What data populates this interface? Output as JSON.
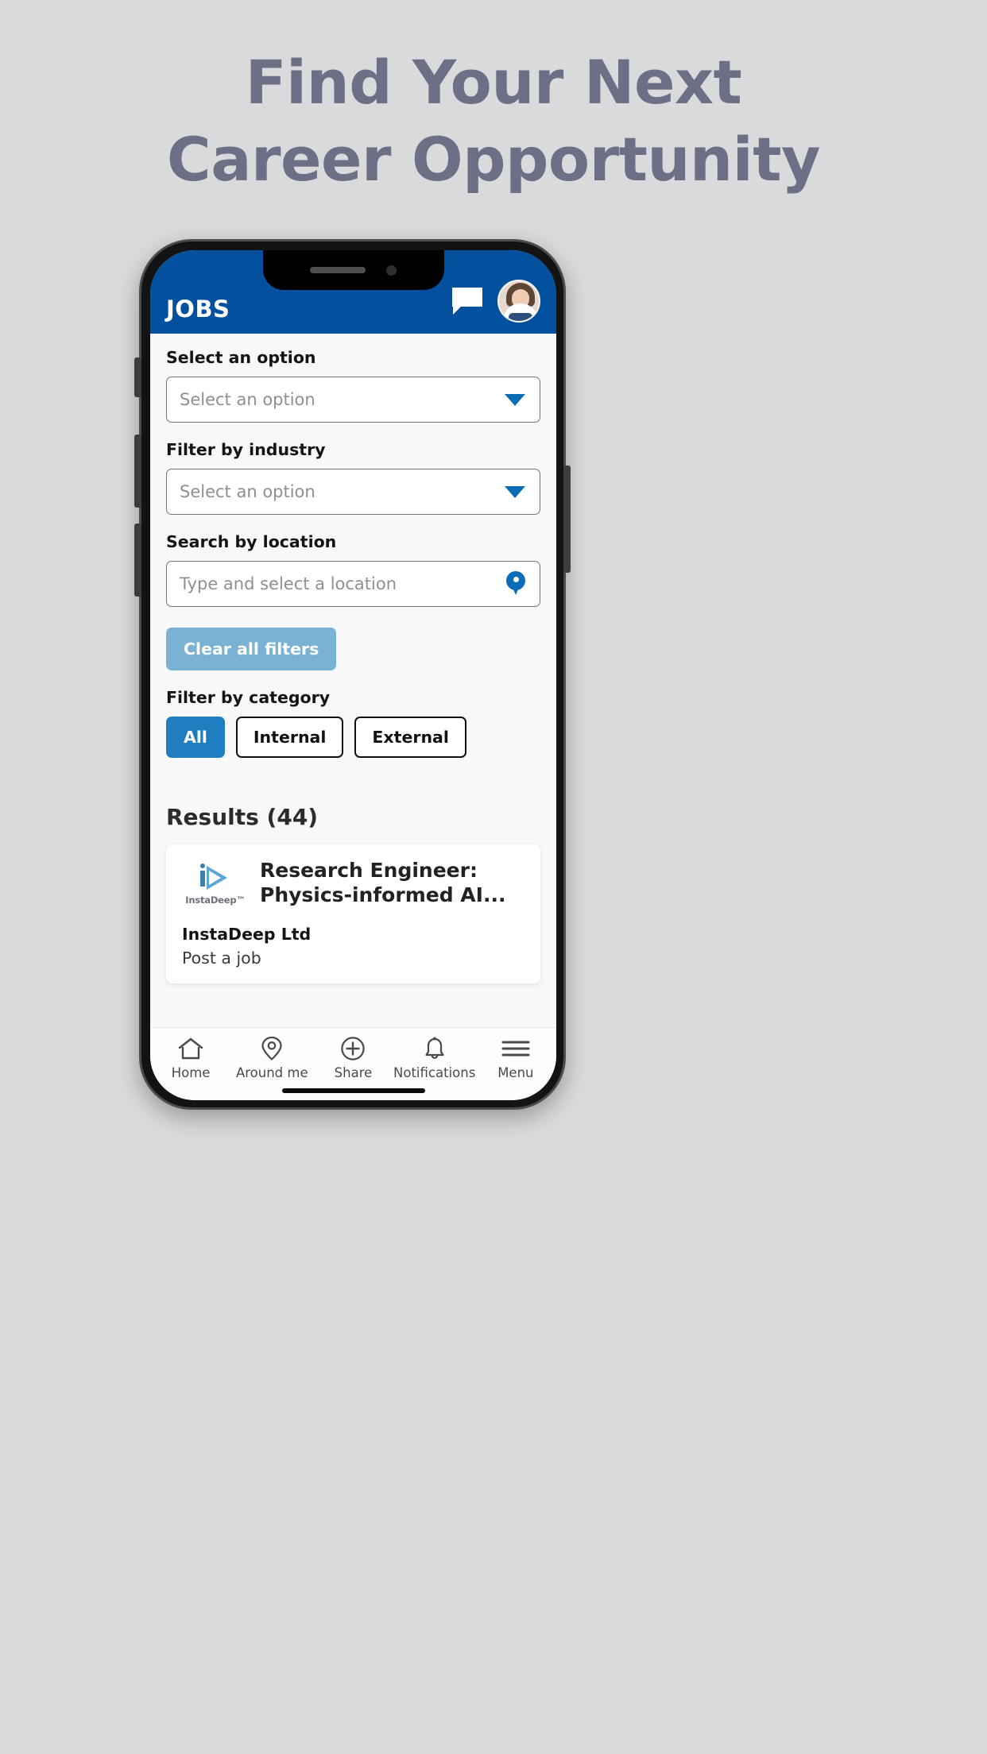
{
  "headline": {
    "line1": "Find Your Next",
    "line2": "Career Opportunity",
    "color": "#6d6f86"
  },
  "app": {
    "header": {
      "title": "JOBS",
      "brand_color": "#03509e",
      "chat_icon": "chat-bubble-icon",
      "avatar": "user-avatar"
    },
    "filters": {
      "option_label": "Select an option",
      "option_value": "",
      "option_placeholder": "Select an option",
      "industry_label": "Filter by industry",
      "industry_value": "",
      "industry_placeholder": "Select an option",
      "location_label": "Search by location",
      "location_value": "",
      "location_placeholder": "Type and select a location",
      "clear_button": "Clear all filters",
      "clear_button_color": "#79b2d5",
      "category_label": "Filter by category",
      "categories": [
        {
          "label": "All",
          "active": true
        },
        {
          "label": "Internal",
          "active": false
        },
        {
          "label": "External",
          "active": false
        }
      ],
      "active_category_color": "#1f7ec0"
    },
    "results": {
      "title": "Results (44)",
      "count": 44,
      "jobs": [
        {
          "title": "Research Engineer: Physics-informed AI...",
          "company": "InstaDeep Ltd",
          "subtitle": "Post a job",
          "logo_text": "InstaDeep™"
        }
      ]
    },
    "bottom_nav": [
      {
        "label": "Home",
        "icon": "home-icon"
      },
      {
        "label": "Around me",
        "icon": "map-pin-icon"
      },
      {
        "label": "Share",
        "icon": "plus-circle-icon"
      },
      {
        "label": "Notifications",
        "icon": "bell-icon"
      },
      {
        "label": "Menu",
        "icon": "hamburger-menu-icon"
      }
    ]
  }
}
